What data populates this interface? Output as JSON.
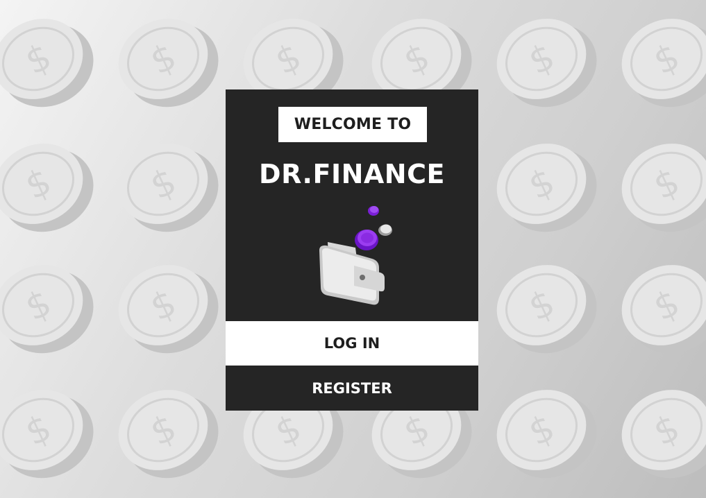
{
  "app": {
    "welcome_label": "WELCOME TO",
    "brand_name": "DR.FINANCE"
  },
  "actions": {
    "login_label": "LOG IN",
    "register_label": "REGISTER"
  },
  "illustration": {
    "icon": "wallet-with-coins-icon",
    "coin_accent_color": "#8a2be2",
    "coin_light_color": "#e6e6e6"
  },
  "background": {
    "icon": "dollar-coin-icon",
    "color": "#d8d8d8"
  },
  "colors": {
    "card": "#252525",
    "button_light": "#ffffff",
    "text_dark": "#1e1e1e",
    "text_light": "#ffffff"
  }
}
